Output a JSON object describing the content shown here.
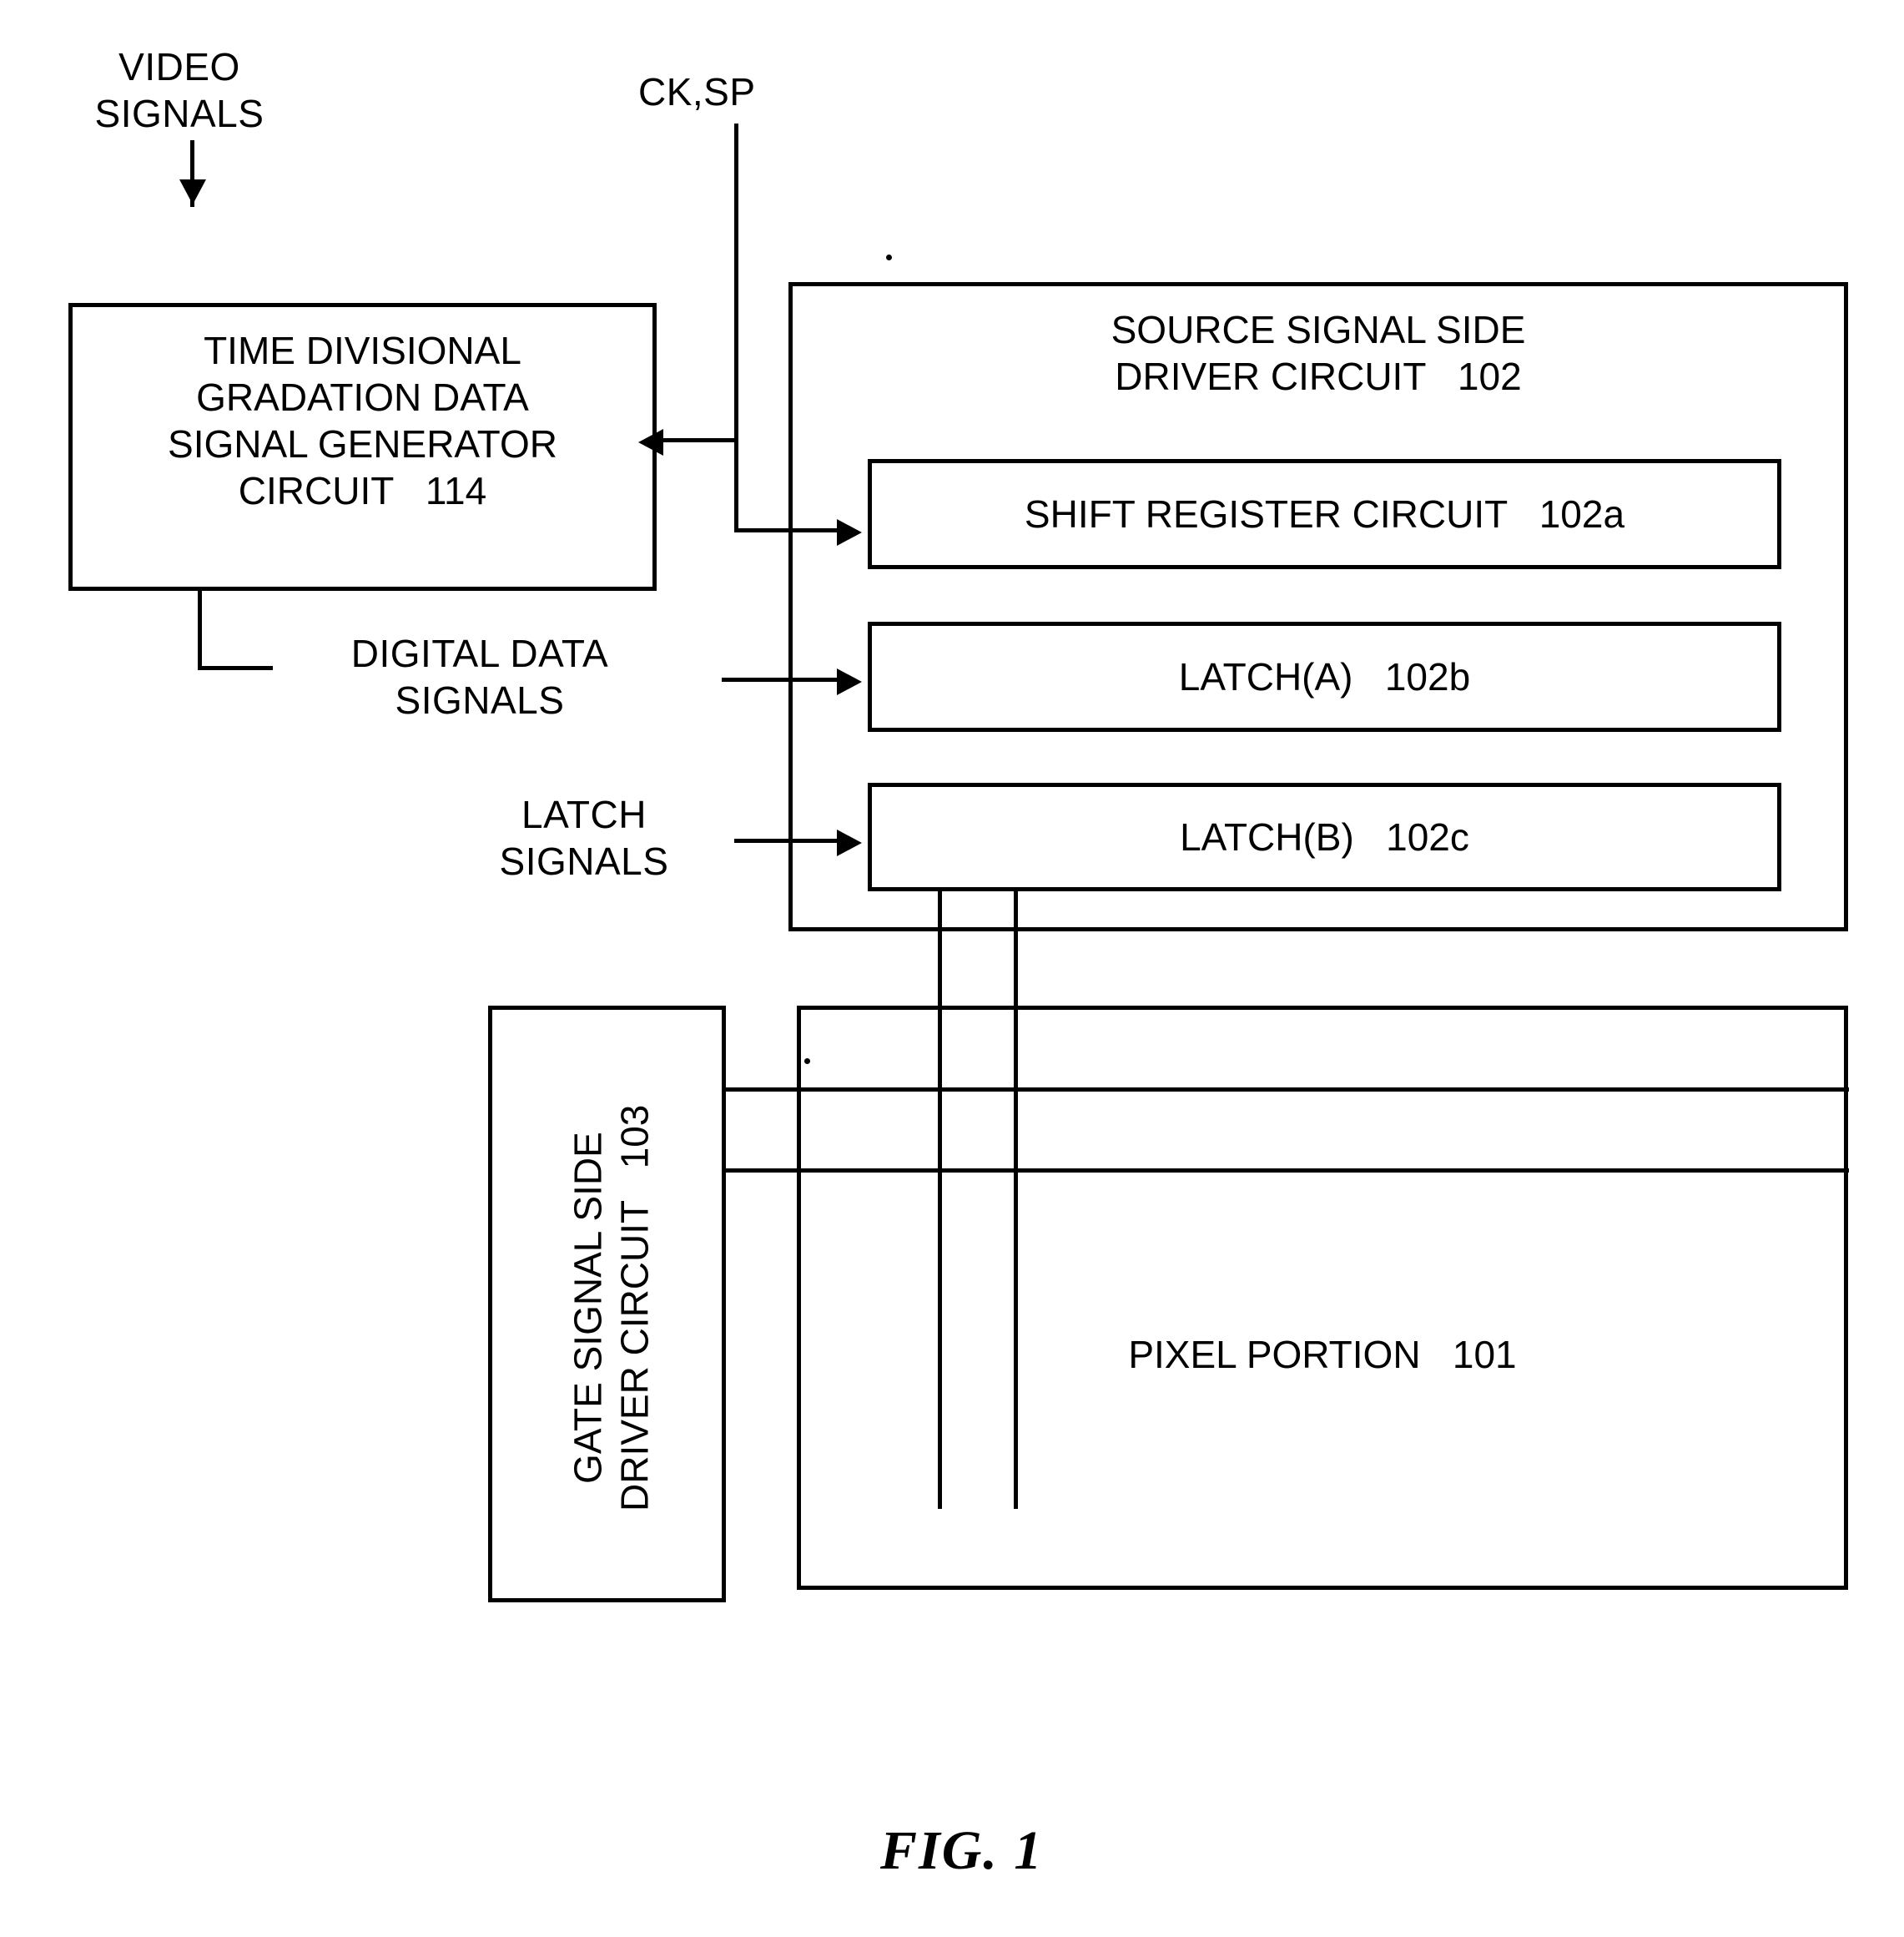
{
  "figure": {
    "caption": "FIG. 1"
  },
  "labels": {
    "video_signals": "VIDEO\nSIGNALS",
    "ck_sp": "CK,SP",
    "digital_data_signals": "DIGITAL DATA\nSIGNALS",
    "latch_signals": "LATCH\nSIGNALS"
  },
  "blocks": {
    "time_divisional": {
      "text": "TIME DIVISIONAL\nGRADATION DATA\nSIGNAL GENERATOR\nCIRCUIT   114"
    },
    "source_driver": {
      "text": "SOURCE SIGNAL SIDE\nDRIVER CIRCUIT   102"
    },
    "shift_register": {
      "text": "SHIFT REGISTER CIRCUIT   102a"
    },
    "latch_a": {
      "text": "LATCH(A)   102b"
    },
    "latch_b": {
      "text": "LATCH(B)   102c"
    },
    "gate_driver": {
      "text": "GATE SIGNAL SIDE\nDRIVER CIRCUIT   103"
    },
    "pixel_portion": {
      "text": "PIXEL PORTION   101"
    }
  },
  "chart_data": {
    "type": "diagram",
    "title": "FIG. 1",
    "nodes": [
      "TIME DIVISIONAL GRADATION DATA SIGNAL GENERATOR CIRCUIT 114",
      "SOURCE SIGNAL SIDE DRIVER CIRCUIT 102",
      "SHIFT REGISTER CIRCUIT 102a",
      "LATCH(A) 102b",
      "LATCH(B) 102c",
      "GATE SIGNAL SIDE DRIVER CIRCUIT 103",
      "PIXEL PORTION 101"
    ],
    "edges": [
      "VIDEO SIGNALS -> TIME DIVISIONAL GRADATION DATA SIGNAL GENERATOR CIRCUIT 114",
      "CK,SP -> TIME DIVISIONAL GRADATION DATA SIGNAL GENERATOR CIRCUIT 114",
      "CK,SP -> SHIFT REGISTER CIRCUIT 102a",
      "DIGITAL DATA SIGNALS -> LATCH(A) 102b",
      "LATCH SIGNALS -> LATCH(B) 102c",
      "LATCH(B) 102c -> PIXEL PORTION 101",
      "GATE SIGNAL SIDE DRIVER CIRCUIT 103 -> PIXEL PORTION 101"
    ]
  }
}
